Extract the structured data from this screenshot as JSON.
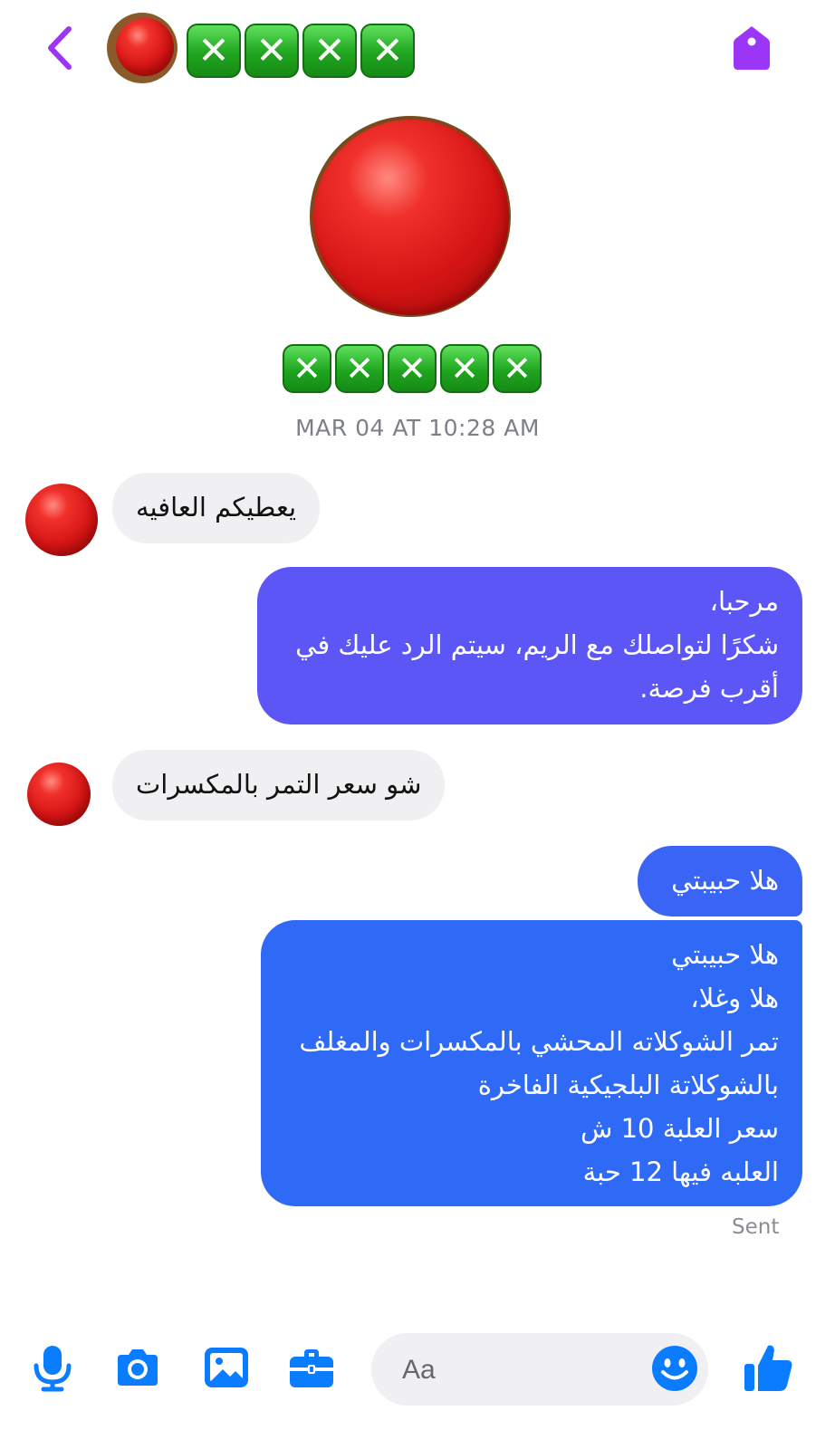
{
  "header": {
    "contact_name_boxes": [
      "✕",
      "✕",
      "✕",
      "✕"
    ],
    "back_icon": "chevron-left-icon",
    "tag_icon": "tag-icon",
    "accent_color": "#9b36f6"
  },
  "profile": {
    "name_boxes": [
      "✕",
      "✕",
      "✕",
      "✕",
      "✕"
    ]
  },
  "timestamp": "MAR 04 AT 10:28 AM",
  "messages": [
    {
      "from": "contact",
      "lines": [
        "يعطيكم العافيه"
      ]
    },
    {
      "from": "me",
      "lines": [
        "مرحبا،",
        "شكرًا لتواصلك مع الريم، سيتم الرد عليك في",
        "أقرب فرصة."
      ]
    },
    {
      "from": "contact",
      "lines": [
        "شو سعر التمر بالمكسرات"
      ]
    },
    {
      "from": "me",
      "lines": [
        "هلا حبيبتي"
      ]
    },
    {
      "from": "me",
      "lines": [
        "هلا  حبيبتي",
        "هلا وغلا،",
        "تمر الشوكلاته المحشي بالمكسرات والمغلف",
        "بالشوكلاتة البلجيكية الفاخرة",
        "سعر العلبة 10 ش",
        "العلبه فيها 12 حبة"
      ]
    }
  ],
  "status": "Sent",
  "composer": {
    "placeholder": "Aa",
    "tools": [
      "microphone-icon",
      "camera-icon",
      "image-icon",
      "briefcase-icon"
    ],
    "emoji_icon": "smiley-icon",
    "like_icon": "thumbs-up-icon",
    "tool_color": "#0a7cff"
  },
  "colors": {
    "bubble_out_top": "#5b56f5",
    "bubble_out_bottom": "#2d6cf7",
    "bubble_in": "#f0f0f2"
  }
}
